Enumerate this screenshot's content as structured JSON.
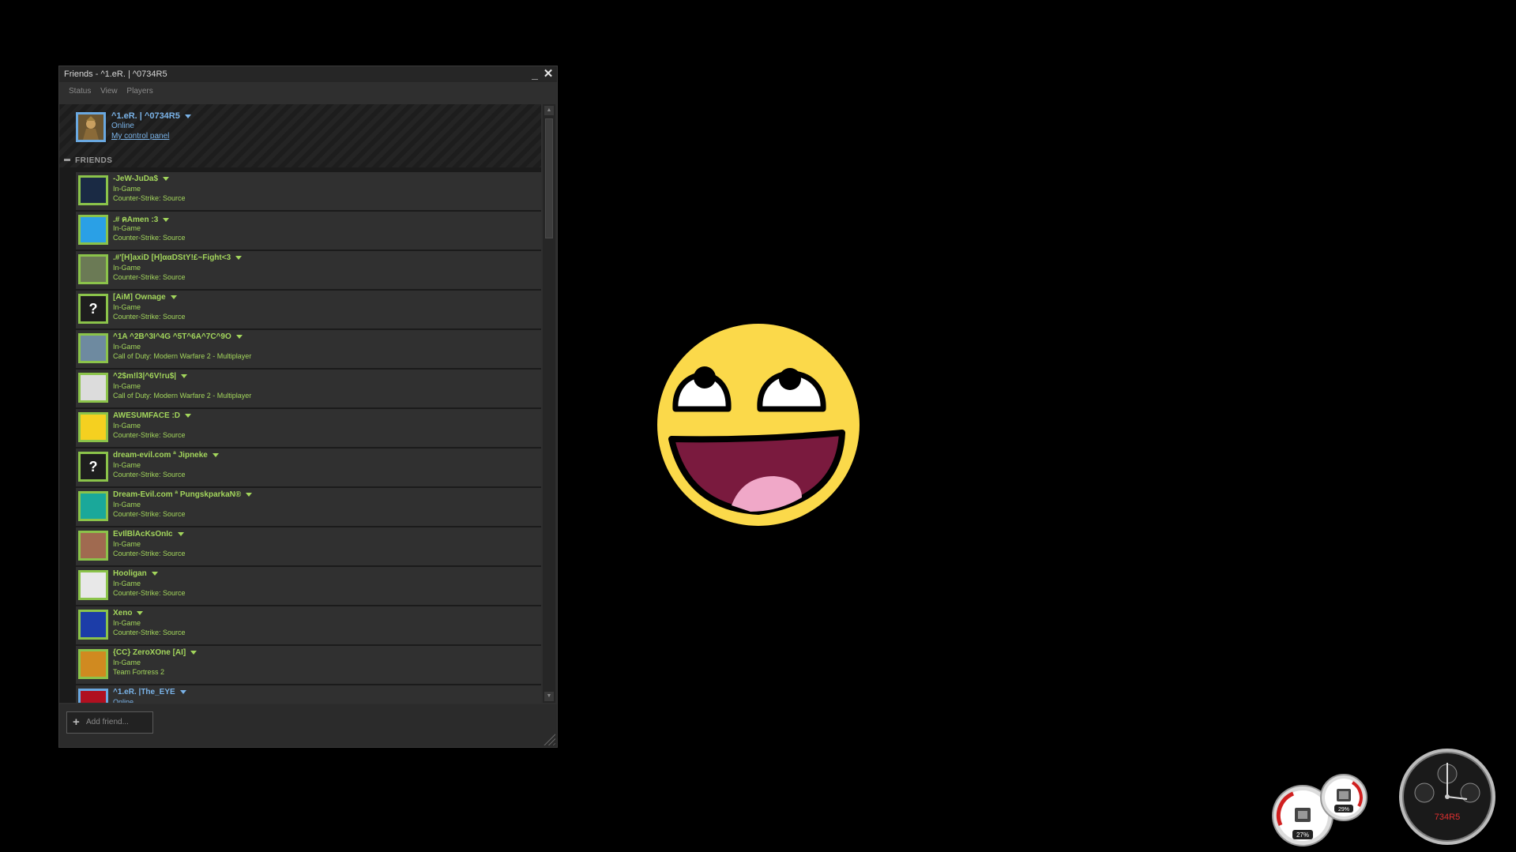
{
  "window": {
    "title": "Friends - ^1.eR. | ^0734R5",
    "minimize_glyph": "_",
    "close_glyph": "✕"
  },
  "menu": [
    "Status",
    "View",
    "Players"
  ],
  "self": {
    "name": "^1.eR. | ^0734R5",
    "status": "Online",
    "link": "My control panel"
  },
  "group": {
    "label": "FRIENDS"
  },
  "friends": [
    {
      "name": "-JeW-JuDa$",
      "status": "In-Game",
      "game": "Counter-Strike: Source",
      "state": "ingame",
      "avatar_icon": "bird-icon",
      "avatar_color": "#1a2a44",
      "avatar_glyph": ""
    },
    {
      "name": ".# คAmen :3",
      "status": "In-Game",
      "game": "Counter-Strike: Source",
      "state": "ingame",
      "avatar_icon": "blue-cartoon-icon",
      "avatar_color": "#2aa0e6",
      "avatar_glyph": ""
    },
    {
      "name": ".#'[H]axiD [H]ααDStY!£~Fight<3",
      "status": "In-Game",
      "game": "Counter-Strike: Source",
      "state": "ingame",
      "avatar_icon": "hammer-icon",
      "avatar_color": "#6b7a55",
      "avatar_glyph": ""
    },
    {
      "name": "[AiM] Ownage",
      "status": "In-Game",
      "game": "Counter-Strike: Source",
      "state": "ingame",
      "avatar_icon": "question-mark-icon",
      "avatar_color": "#1e1e1e",
      "avatar_glyph": "?"
    },
    {
      "name": "^1A ^2B^3I^4G ^5T^6A^7C^9O",
      "status": "In-Game",
      "game": "Call of Duty: Modern Warfare 2 - Multiplayer",
      "state": "ingame",
      "avatar_icon": "koala-icon",
      "avatar_color": "#6e8aa0",
      "avatar_glyph": ""
    },
    {
      "name": "^2$m!l3|^6V!ru$|",
      "status": "In-Game",
      "game": "Call of Duty: Modern Warfare 2 - Multiplayer",
      "state": "ingame",
      "avatar_icon": "sticker-icon",
      "avatar_color": "#dcdcdc",
      "avatar_glyph": ""
    },
    {
      "name": "AWESUMFACE :D",
      "status": "In-Game",
      "game": "Counter-Strike: Source",
      "state": "ingame",
      "avatar_icon": "awesome-face-icon",
      "avatar_color": "#f5d020",
      "avatar_glyph": ""
    },
    {
      "name": "dream-evil.com ª Jipneke",
      "status": "In-Game",
      "game": "Counter-Strike: Source",
      "state": "ingame",
      "avatar_icon": "question-mark-icon",
      "avatar_color": "#1e1e1e",
      "avatar_glyph": "?"
    },
    {
      "name": "Dream-Evil.com ª PungskparkaN®",
      "status": "In-Game",
      "game": "Counter-Strike: Source",
      "state": "ingame",
      "avatar_icon": "noob-badge-icon",
      "avatar_color": "#1aa89a",
      "avatar_glyph": ""
    },
    {
      "name": "EvIlBlAcKsOnIc",
      "status": "In-Game",
      "game": "Counter-Strike: Source",
      "state": "ingame",
      "avatar_icon": "portrait-icon",
      "avatar_color": "#a06a50",
      "avatar_glyph": ""
    },
    {
      "name": "Hooligan",
      "status": "In-Game",
      "game": "Counter-Strike: Source",
      "state": "ingame",
      "avatar_icon": "hooligan-logo-icon",
      "avatar_color": "#e8e8e8",
      "avatar_glyph": ""
    },
    {
      "name": "Xeno",
      "status": "In-Game",
      "game": "Counter-Strike: Source",
      "state": "ingame",
      "avatar_icon": "blue-s-logo-icon",
      "avatar_color": "#1c3da8",
      "avatar_glyph": ""
    },
    {
      "name": "{CC} ZeroXOne [AI]",
      "status": "In-Game",
      "game": "Team Fortress 2",
      "state": "ingame",
      "avatar_icon": "flame-figure-icon",
      "avatar_color": "#d08a20",
      "avatar_glyph": ""
    },
    {
      "name": "^1.eR. |The_EYE",
      "status": "Online",
      "game": "",
      "state": "online",
      "avatar_icon": "red-eye-icon",
      "avatar_color": "#b01020",
      "avatar_glyph": ""
    }
  ],
  "add_friend": {
    "placeholder": "Add friend...",
    "icon": "plus-icon"
  },
  "gadgets": {
    "cpu_percent": "27%",
    "memory_percent": "29%",
    "clock_label": "734R5"
  },
  "colors": {
    "ingame_green": "#a3d65c",
    "online_blue": "#7ab3e8",
    "face_yellow": "#fbd94a",
    "mouth": "#7a1a3e",
    "tongue": "#f0a8c8"
  }
}
